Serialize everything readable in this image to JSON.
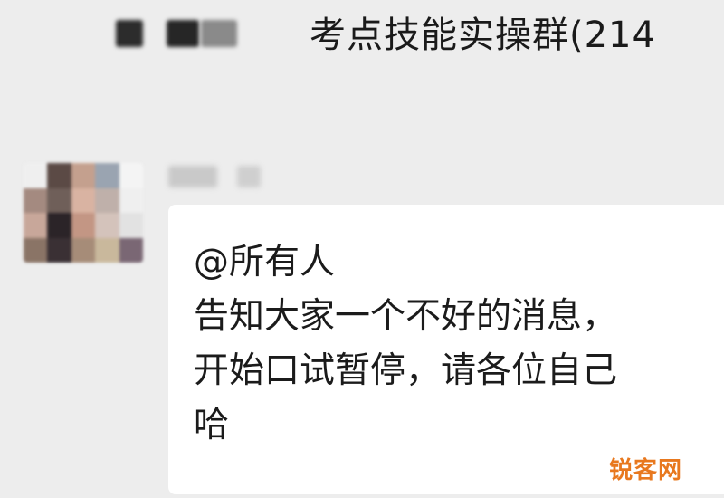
{
  "header": {
    "title": "考点技能实操群(214"
  },
  "message": {
    "lines": [
      "@所有人",
      "告知大家一个不好的消息，",
      "开始口试暂停，请各位自己",
      "哈"
    ]
  },
  "watermark": {
    "text": "锐客网"
  },
  "colors": {
    "background": "#ededed",
    "bubble": "#ffffff",
    "text": "#1b1b1b",
    "watermark": "#e8781e"
  }
}
